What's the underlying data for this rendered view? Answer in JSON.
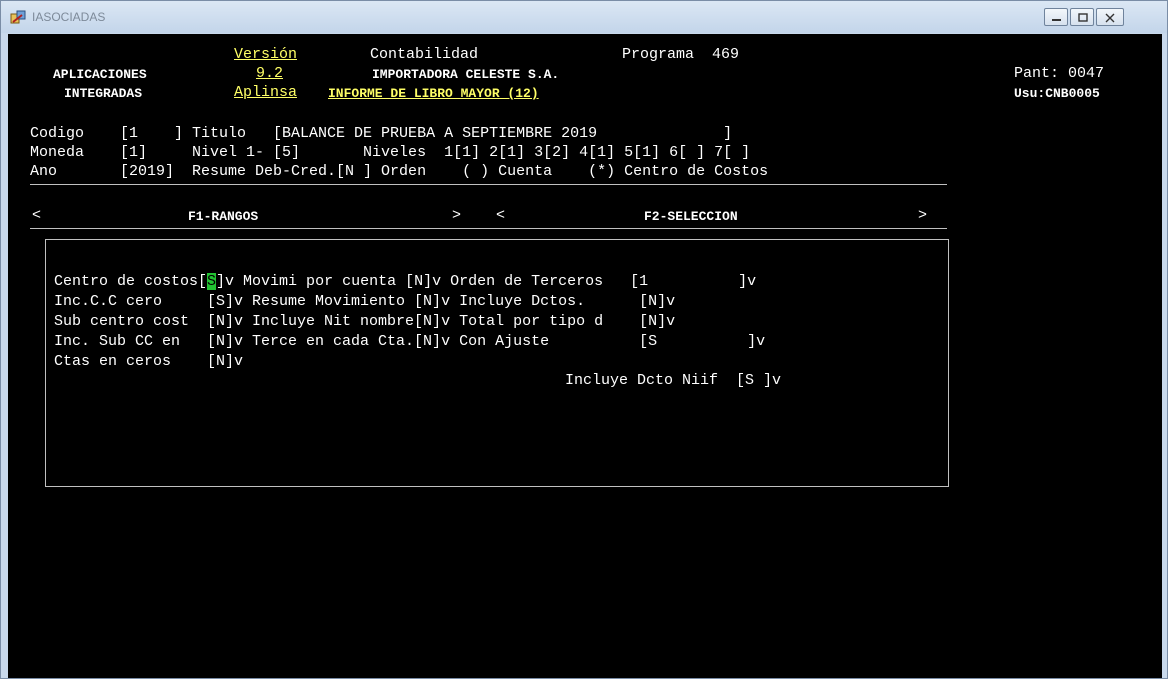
{
  "window": {
    "title": "IASOCIADAS"
  },
  "header": {
    "version_label": "Versión",
    "version_value": "9.2",
    "module_label": "Aplinsa",
    "apps_line1": "APLICACIONES",
    "apps_line2": "INTEGRADAS",
    "system": "Contabilidad",
    "program": "Programa  469",
    "company": "IMPORTADORA CELESTE S.A.",
    "report": "INFORME DE LIBRO MAYOR (12)",
    "screen": "Pant: 0047",
    "user": "Usu:CNB0005"
  },
  "params": {
    "line1": "Codigo    [1    ] Titulo   [BALANCE DE PRUEBA A SEPTIEMBRE 2019              ]",
    "line2": "Moneda    [1]     Nivel 1- [5]       Niveles  1[1] 2[1] 3[2] 4[1] 5[1] 6[ ] 7[ ]",
    "line3": "Ano       [2019]  Resume Deb-Cred.[N ] Orden    ( ) Cuenta    (*) Centro de Costos"
  },
  "tabs": {
    "f1_left": "<",
    "f1_label": "F1-RANGOS",
    "f1_right": ">",
    "f2_left": "<",
    "f2_label": "F2-SELECCION",
    "f2_right": ">"
  },
  "panel": {
    "row1_a": "Centro de costos[",
    "row1_cursor": "S",
    "row1_b": "]v Movimi por cuenta [N]v Orden de Terceros   [1          ]v",
    "row2": "Inc.C.C cero     [S]v Resume Movimiento [N]v Incluye Dctos.      [N]v",
    "row3": "Sub centro cost  [N]v Incluye Nit nombre[N]v Total por tipo d    [N]v",
    "row4": "Inc. Sub CC en   [N]v Terce en cada Cta.[N]v Con Ajuste          [S          ]v",
    "row5": "Ctas en ceros    [N]v",
    "row6": "Incluye Dcto Niif  [S ]v"
  },
  "colors": {
    "background": "#000000",
    "text": "#ffffff",
    "highlight": "#ffff66",
    "cursor": "#22c232"
  }
}
